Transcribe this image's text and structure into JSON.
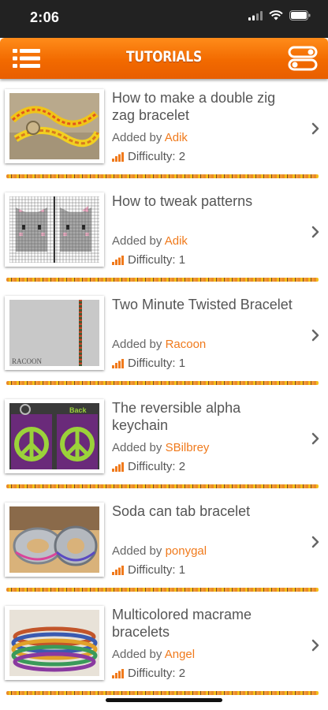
{
  "status_bar": {
    "time": "2:06"
  },
  "nav": {
    "title": "TUTORIALS",
    "menu_icon": "list-menu-icon",
    "toggle_icon": "toggle-switch-icon"
  },
  "colors": {
    "accent": "#f26a00",
    "author": "#f07a1c",
    "text": "#555555"
  },
  "tutorials": [
    {
      "title": "How to make a double zig zag bracelet",
      "added_by_label": "Added by",
      "author": "Adik",
      "difficulty_label": "Difficulty:",
      "difficulty": "2",
      "thumbnail": "double zig zag bracelet photo"
    },
    {
      "title": "How to tweak patterns",
      "added_by_label": "Added by",
      "author": "Adik",
      "difficulty_label": "Difficulty:",
      "difficulty": "1",
      "thumbnail": "pixel cat pattern"
    },
    {
      "title": "Two Minute Twisted Bracelet",
      "added_by_label": "Added by",
      "author": "Racoon",
      "difficulty_label": "Difficulty:",
      "difficulty": "1",
      "thumbnail": "twisted bracelet photo",
      "thumbnail_text": "RACOON"
    },
    {
      "title": "The reversible alpha keychain",
      "added_by_label": "Added by",
      "author": "SBilbrey",
      "difficulty_label": "Difficulty:",
      "difficulty": "2",
      "thumbnail": "peace sign keychains",
      "thumbnail_text": "Back"
    },
    {
      "title": "Soda can tab bracelet",
      "added_by_label": "Added by",
      "author": "ponygal",
      "difficulty_label": "Difficulty:",
      "difficulty": "1",
      "thumbnail": "soda can tab bracelets"
    },
    {
      "title": "Multicolored macrame bracelets",
      "added_by_label": "Added by",
      "author": "Angel",
      "difficulty_label": "Difficulty:",
      "difficulty": "2",
      "thumbnail": "stacked macrame bracelets"
    }
  ]
}
